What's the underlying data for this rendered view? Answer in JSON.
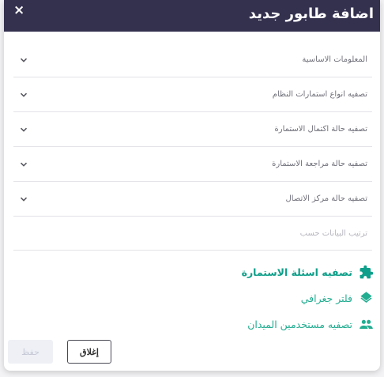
{
  "header": {
    "title": "اضافة طابور جديد",
    "close_glyph": "×"
  },
  "sections": [
    {
      "label": "المعلومات الاساسية"
    },
    {
      "label": "تصفيه انواع استمارات النظام"
    },
    {
      "label": "تصفيه حالة اكتمال الاستمارة"
    },
    {
      "label": "تصفيه حالة مراجعة الاستمارة"
    },
    {
      "label": "تصفيه حالة مركز الاتصال"
    }
  ],
  "sort": {
    "label": "ترتيب البيانات حسب"
  },
  "links": [
    {
      "label": "تصفيه اسئلة الاستمارة",
      "icon": "puzzle-icon"
    },
    {
      "label": "فلتر جغرافي",
      "icon": "layers-icon"
    },
    {
      "label": "تصفيه مستخدمين الميدان",
      "icon": "users-icon"
    }
  ],
  "footer": {
    "save_label": "حفظ",
    "close_label": "إغلاق"
  },
  "colors": {
    "header_bg": "#34314f",
    "accent": "#0f9f8a"
  }
}
